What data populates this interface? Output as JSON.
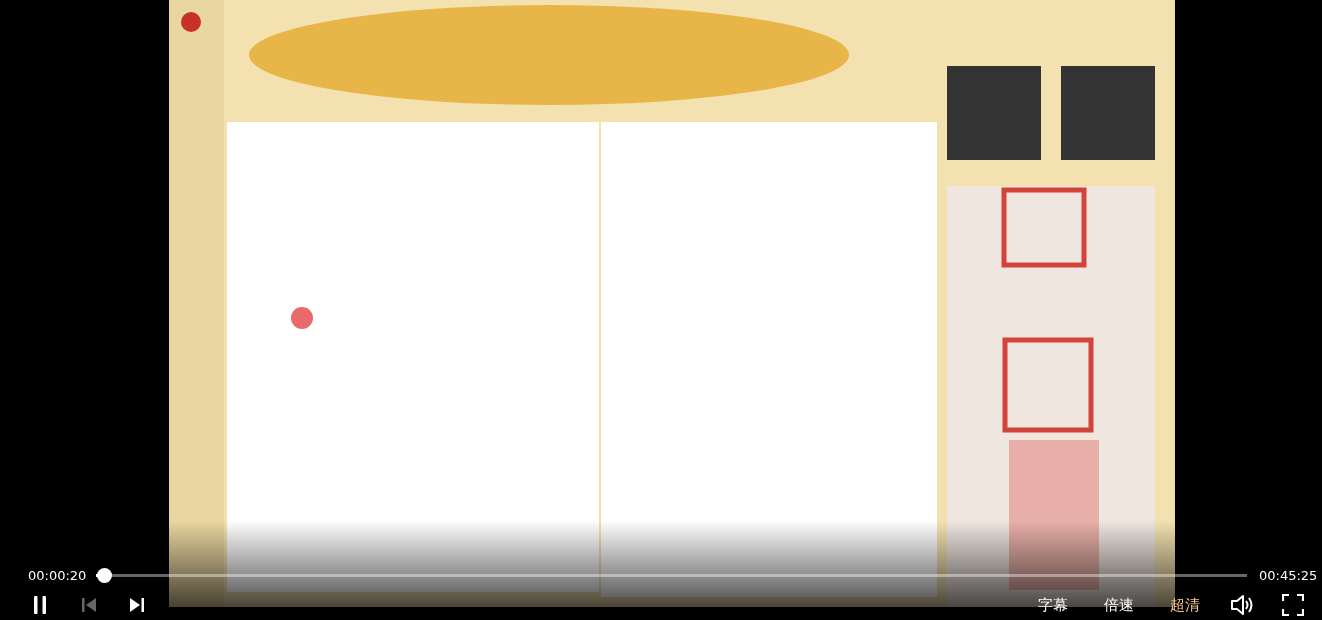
{
  "progress": {
    "elapsed": "00:00:20",
    "duration": "00:45:25",
    "level": 0.0073
  },
  "controls": {
    "playing": true,
    "previous": {
      "disabled": true
    },
    "next": {
      "disabled": false
    }
  },
  "text_buttons": [
    {
      "label": "字幕",
      "selected": false
    },
    {
      "label": "倍速",
      "selected": false
    },
    {
      "label": "超清",
      "selected": true
    }
  ]
}
